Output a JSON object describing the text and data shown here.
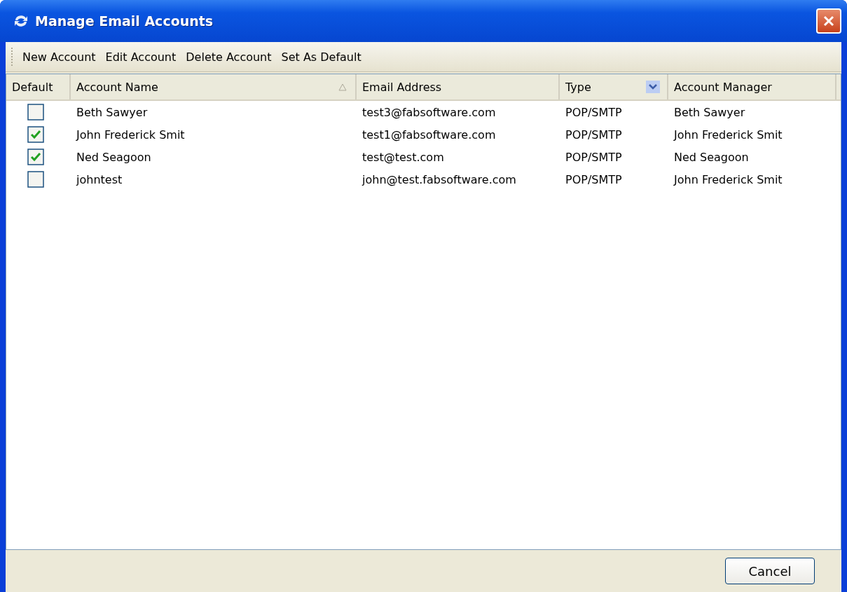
{
  "window": {
    "title": "Manage Email Accounts"
  },
  "toolbar": [
    "New Account",
    "Edit Account",
    "Delete Account",
    "Set As Default"
  ],
  "table": {
    "columns": [
      {
        "label": "Default",
        "sorted": false,
        "filter": false
      },
      {
        "label": "Account Name",
        "sorted": true,
        "filter": false
      },
      {
        "label": "Email Address",
        "sorted": false,
        "filter": false
      },
      {
        "label": "Type",
        "sorted": false,
        "filter": true
      },
      {
        "label": "Account Manager",
        "sorted": false,
        "filter": false
      }
    ],
    "rows": [
      {
        "checked": false,
        "name": "Beth Sawyer",
        "email": "test3@fabsoftware.com",
        "type": "POP/SMTP",
        "manager": "Beth Sawyer"
      },
      {
        "checked": true,
        "name": "John Frederick Smit",
        "email": "test1@fabsoftware.com",
        "type": "POP/SMTP",
        "manager": "John Frederick Smit"
      },
      {
        "checked": true,
        "name": "Ned Seagoon",
        "email": "test@test.com",
        "type": "POP/SMTP",
        "manager": "Ned Seagoon"
      },
      {
        "checked": false,
        "name": "johntest",
        "email": "john@test.fabsoftware.com",
        "type": "POP/SMTP",
        "manager": "John Frederick Smit"
      }
    ]
  },
  "buttons": [
    "Cancel"
  ]
}
